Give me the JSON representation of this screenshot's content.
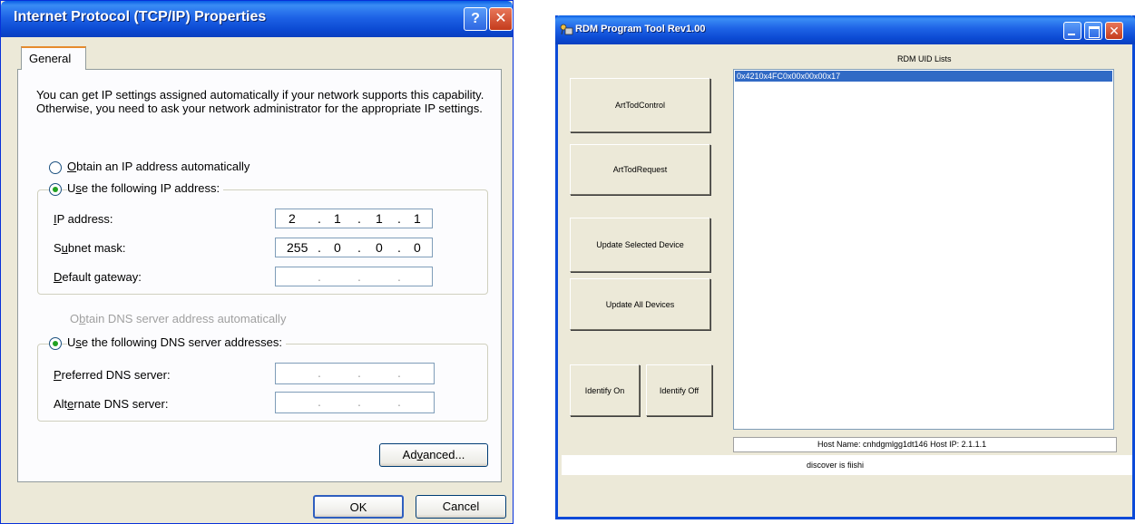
{
  "tcpip_dialog": {
    "title": "Internet Protocol (TCP/IP) Properties",
    "help_glyph": "?",
    "close_glyph": "✕",
    "tab_general": "General",
    "intro_text": "You can get IP settings assigned automatically if your network supports this capability. Otherwise, you need to ask your network administrator for the appropriate IP settings.",
    "radio_auto_ip": {
      "first": "O",
      "rest": "btain an IP address automatically",
      "selected": false
    },
    "radio_static_ip": {
      "first": "U",
      "u": "s",
      "rest": "e the following IP address:",
      "selected": true
    },
    "ip_address": {
      "first": "I",
      "rest": "P address:",
      "octets": [
        "2",
        "1",
        "1",
        "1"
      ]
    },
    "subnet_mask": {
      "pre": "S",
      "u": "u",
      "rest": "bnet mask:",
      "octets": [
        "255",
        "0",
        "0",
        "0"
      ]
    },
    "default_gateway": {
      "first": "D",
      "rest": "efault gateway:",
      "octets": [
        "",
        "",
        "",
        ""
      ]
    },
    "radio_auto_dns": {
      "pre": "O",
      "u": "b",
      "rest": "tain DNS server address automatically",
      "selected": false,
      "enabled": false
    },
    "radio_static_dns": {
      "pre": "U",
      "u": "s",
      "rest": "e the following DNS server addresses:",
      "selected": true
    },
    "preferred_dns": {
      "first": "P",
      "rest": "referred DNS server:",
      "octets": [
        "",
        "",
        "",
        ""
      ]
    },
    "alternate_dns": {
      "pre": "Alt",
      "u": "e",
      "rest": "rnate DNS server:",
      "octets": [
        "",
        "",
        "",
        ""
      ]
    },
    "advanced_button": {
      "pre": "Ad",
      "u": "v",
      "rest": "anced..."
    },
    "ok_button": "OK",
    "cancel_button": "Cancel"
  },
  "rdm_tool": {
    "title": "RDM Program Tool Rev1.00",
    "close_glyph": "✕",
    "buttons": {
      "art_tod_control": "ArtTodControl",
      "art_tod_request": "ArtTodRequest",
      "update_selected": "Update Selected Device",
      "update_all": "Update All Devices",
      "identify_on": "Identify On",
      "identify_off": "Identify Off"
    },
    "uid_list_title": "RDM UID Lists",
    "uid_items": [
      "0x4210x4FC0x00x00x00x17"
    ],
    "host_line": "Host Name: cnhdgmlgg1dt146    Host IP: 2.1.1.1",
    "status_text": "discover is fiishi"
  },
  "colors": {
    "xp_titlebar": "#0b49d2",
    "xp_face": "#ece9d8",
    "selection": "#316ac5",
    "radio_dot": "#21a121"
  }
}
